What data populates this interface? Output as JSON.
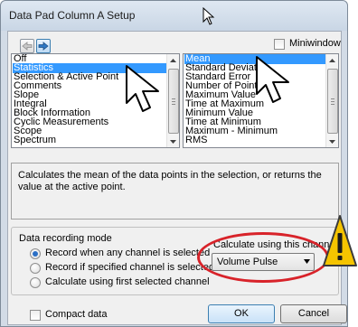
{
  "window": {
    "title": "Data Pad Column A Setup"
  },
  "miniwindow": {
    "label": "Miniwindow",
    "checked": false
  },
  "left_list": {
    "items": [
      "Off",
      "Statistics",
      "Selection & Active Point",
      "Comments",
      "Slope",
      "Integral",
      "Block Information",
      "Cyclic Measurements",
      "Scope",
      "Spectrum"
    ],
    "selected": "Statistics"
  },
  "right_list": {
    "items": [
      "Mean",
      "Standard Deviation",
      "Standard Error",
      "Number of Points",
      "Maximum Value",
      "Time at Maximum",
      "Minimum Value",
      "Time at Minimum",
      "Maximum - Minimum",
      "RMS"
    ],
    "selected": "Mean"
  },
  "description": "Calculates the mean of the data points in the selection, or returns the value at the active point.",
  "recording": {
    "group_label": "Data recording mode",
    "options": [
      "Record when any channel is selected",
      "Record if specified channel is selected",
      "Calculate using first selected channel"
    ],
    "selected_index": 0
  },
  "calculate": {
    "label": "Calculate using this channel:",
    "value": "Volume Pulse"
  },
  "compact": {
    "label": "Compact data",
    "checked": false
  },
  "buttons": {
    "ok": "OK",
    "cancel": "Cancel"
  },
  "colors": {
    "selection": "#3399ff",
    "highlight_ring": "#d8232a",
    "warning": "#f5c400"
  },
  "icons": [
    "back-arrow-icon",
    "forward-arrow-icon",
    "dropdown-arrow-icon",
    "mouse-cursor-icon",
    "warning-icon"
  ]
}
